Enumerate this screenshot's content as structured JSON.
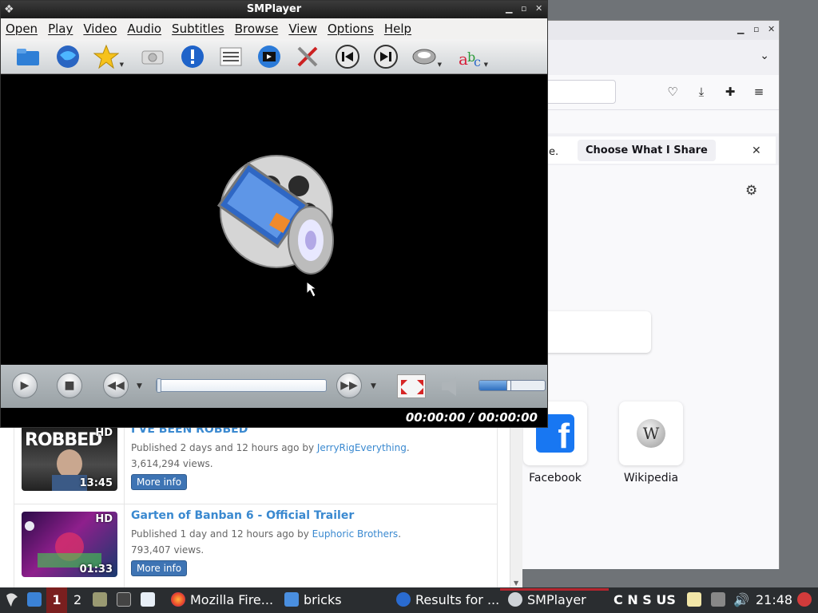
{
  "smplayer": {
    "title": "SMPlayer",
    "menu": [
      "Open",
      "Play",
      "Video",
      "Audio",
      "Subtitles",
      "Browse",
      "View",
      "Options",
      "Help"
    ],
    "time_display": "00:00:00 / 00:00:00",
    "volume_level": 0.45,
    "seek_position": 0.0
  },
  "firefox": {
    "notification_partial": "e.",
    "share_button": "Choose What I Share",
    "shortcuts": [
      {
        "label": "Facebook",
        "icon": "facebook-icon"
      },
      {
        "label": "Wikipedia",
        "icon": "wikipedia-icon"
      }
    ]
  },
  "results": [
    {
      "title": "I'VE BEEN ROBBED",
      "published": "Published 2 days and 12 hours ago by ",
      "channel": "JerryRigEverything",
      "views": "3,614,294 views.",
      "more": "More info",
      "hd": "HD",
      "duration": "13:45",
      "thumb_text": "ROBBED"
    },
    {
      "title": "Garten of Banban 6 - Official Trailer",
      "published": "Published 1 day and 12 hours ago by ",
      "channel": "Euphoric Brothers",
      "views": "793,407 views.",
      "more": "More info",
      "hd": "HD",
      "duration": "01:33"
    }
  ],
  "taskbar": {
    "workspaces": [
      "1",
      "2"
    ],
    "tasks": [
      {
        "label": "Mozilla Fire...",
        "icon": "firefox-icon"
      },
      {
        "label": "bricks",
        "icon": "folder-icon"
      },
      {
        "label": "Results for ...",
        "icon": "smplayer-icon"
      },
      {
        "label": "SMPlayer",
        "icon": "smplayer-icon"
      }
    ],
    "tray_text": "C N S US",
    "clock": "21:48"
  }
}
